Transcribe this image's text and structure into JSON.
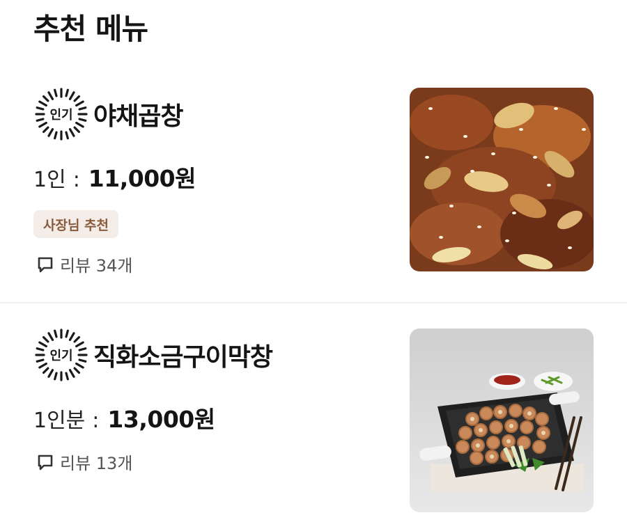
{
  "section": {
    "title": "추천 메뉴"
  },
  "items": [
    {
      "badge": "인기",
      "name": "야채곱창",
      "price_unit": "1인",
      "price_sep": ":",
      "price": "11,000원",
      "owner_tag": "사장님 추천",
      "review": "리뷰 34개",
      "image_icon": "stir-fried-gopchang-photo"
    },
    {
      "badge": "인기",
      "name": "직화소금구이막창",
      "price_unit": "1인분",
      "price_sep": ":",
      "price": "13,000원",
      "review": "리뷰 13개",
      "image_icon": "grilled-makchang-photo"
    }
  ],
  "colors": {
    "tag_bg": "#f3ece7",
    "tag_text": "#8a5a3c",
    "divider": "#efefef"
  }
}
